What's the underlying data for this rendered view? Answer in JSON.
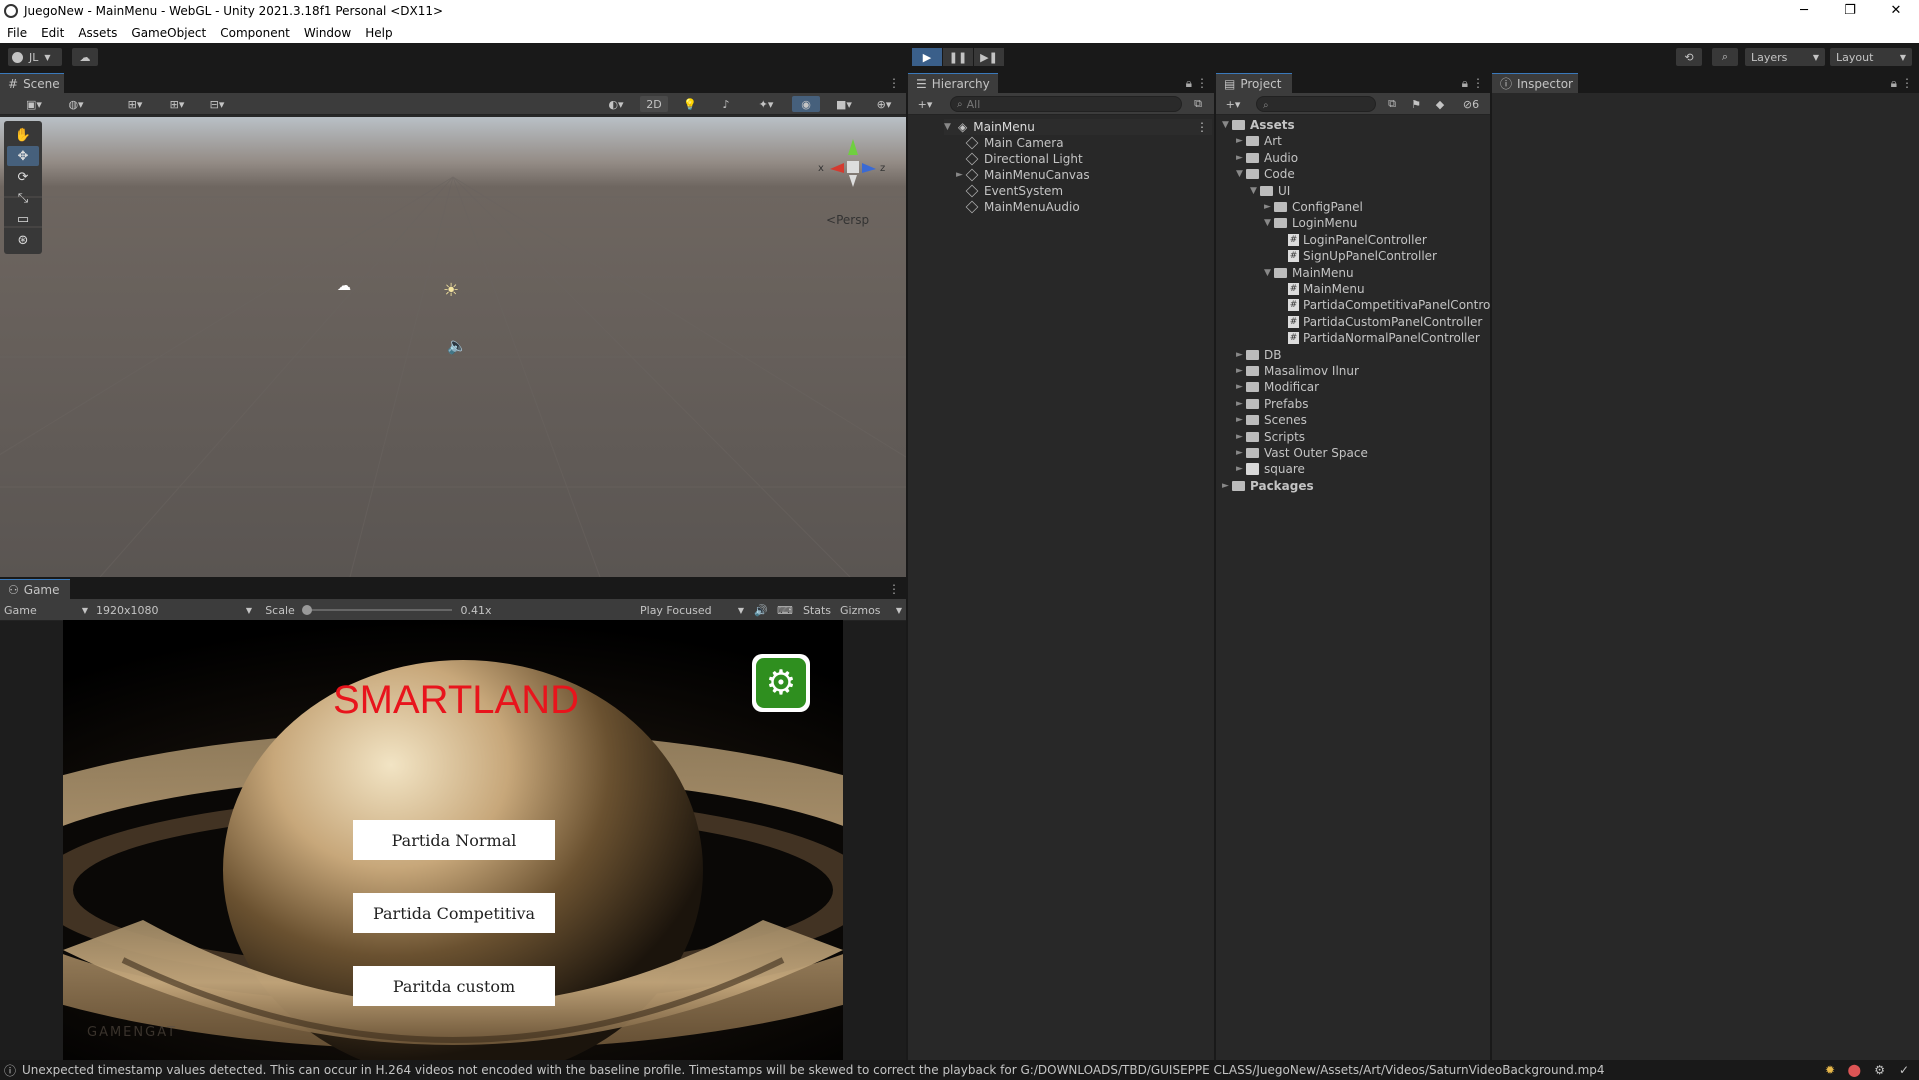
{
  "window": {
    "title": "JuegoNew - MainMenu - WebGL - Unity 2021.3.18f1 Personal <DX11>",
    "controls": [
      "─",
      "❐",
      "✕"
    ]
  },
  "menu": [
    "File",
    "Edit",
    "Assets",
    "GameObject",
    "Component",
    "Window",
    "Help"
  ],
  "toolbar": {
    "account": "JL",
    "layers": "Layers",
    "layout": "Layout"
  },
  "scene": {
    "tab_label": "Scene",
    "mode_2d": "2D",
    "persp_label": "Persp",
    "gizmo_axes": {
      "x": "x",
      "z": "z"
    }
  },
  "game": {
    "tab_label": "Game",
    "display": "Game",
    "resolution": "1920x1080",
    "scale_label": "Scale",
    "scale_value": "0.41x",
    "play_mode": "Play Focused",
    "stats": "Stats",
    "gizmos": "Gizmos",
    "title": "SMARTLAND",
    "buttons": [
      "Partida Normal",
      "Partida Competitiva",
      "Paritda custom"
    ],
    "watermark": "GAMENGAT",
    "title_color": "#e8141c",
    "settings_color": "#2f8f1f"
  },
  "hierarchy": {
    "tab_label": "Hierarchy",
    "search_placeholder": "All",
    "scene_name": "MainMenu",
    "items": [
      "Main Camera",
      "Directional Light",
      "MainMenuCanvas",
      "EventSystem",
      "MainMenuAudio"
    ]
  },
  "project": {
    "tab_label": "Project",
    "count": "6",
    "tree": [
      {
        "label": "Assets",
        "depth": 0,
        "type": "folder",
        "fold": "▼",
        "bold": true
      },
      {
        "label": "Art",
        "depth": 1,
        "type": "folder",
        "fold": "►"
      },
      {
        "label": "Audio",
        "depth": 1,
        "type": "folder",
        "fold": "►"
      },
      {
        "label": "Code",
        "depth": 1,
        "type": "folder",
        "fold": "▼"
      },
      {
        "label": "UI",
        "depth": 2,
        "type": "folder",
        "fold": "▼"
      },
      {
        "label": "ConfigPanel",
        "depth": 3,
        "type": "folder",
        "fold": "►"
      },
      {
        "label": "LoginMenu",
        "depth": 3,
        "type": "folder",
        "fold": "▼"
      },
      {
        "label": "LoginPanelController",
        "depth": 4,
        "type": "script",
        "fold": ""
      },
      {
        "label": "SignUpPanelController",
        "depth": 4,
        "type": "script",
        "fold": ""
      },
      {
        "label": "MainMenu",
        "depth": 3,
        "type": "folder",
        "fold": "▼"
      },
      {
        "label": "MainMenu",
        "depth": 4,
        "type": "script",
        "fold": ""
      },
      {
        "label": "PartidaCompetitivaPanelControl",
        "depth": 4,
        "type": "script",
        "fold": ""
      },
      {
        "label": "PartidaCustomPanelController",
        "depth": 4,
        "type": "script",
        "fold": ""
      },
      {
        "label": "PartidaNormalPanelController",
        "depth": 4,
        "type": "script",
        "fold": ""
      },
      {
        "label": "DB",
        "depth": 1,
        "type": "folder",
        "fold": "►"
      },
      {
        "label": "Masalimov Ilnur",
        "depth": 1,
        "type": "folder",
        "fold": "►"
      },
      {
        "label": "Modificar",
        "depth": 1,
        "type": "folder",
        "fold": "►"
      },
      {
        "label": "Prefabs",
        "depth": 1,
        "type": "folder",
        "fold": "►"
      },
      {
        "label": "Scenes",
        "depth": 1,
        "type": "folder",
        "fold": "►"
      },
      {
        "label": "Scripts",
        "depth": 1,
        "type": "folder",
        "fold": "►"
      },
      {
        "label": "Vast Outer Space",
        "depth": 1,
        "type": "folder",
        "fold": "►"
      },
      {
        "label": "square",
        "depth": 1,
        "type": "asset",
        "fold": "►"
      },
      {
        "label": "Packages",
        "depth": 0,
        "type": "folder",
        "fold": "►",
        "bold": true
      }
    ]
  },
  "inspector": {
    "tab_label": "Inspector"
  },
  "status": {
    "message": "Unexpected timestamp values detected. This can occur in H.264 videos not encoded with the baseline profile. Timestamps will be skewed to correct the playback for G:/DOWNLOADS/TBD/GUISEPPE CLASS/JuegoNew/Assets/Art/Videos/SaturnVideoBackground.mp4"
  }
}
